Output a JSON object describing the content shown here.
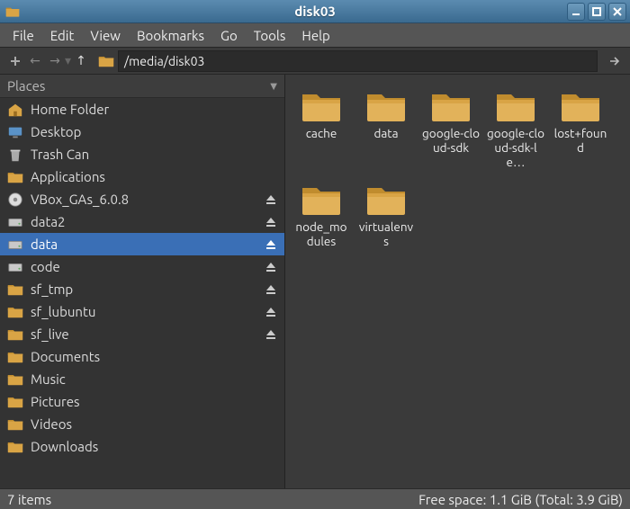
{
  "window": {
    "title": "disk03"
  },
  "menu": {
    "file": "File",
    "edit": "Edit",
    "view": "View",
    "bookmarks": "Bookmarks",
    "go": "Go",
    "tools": "Tools",
    "help": "Help"
  },
  "toolbar": {
    "path": "/media/disk03"
  },
  "sidebar": {
    "header": "Places",
    "items": [
      {
        "label": "Home Folder",
        "icon": "home",
        "eject": false,
        "selected": false
      },
      {
        "label": "Desktop",
        "icon": "desktop",
        "eject": false,
        "selected": false
      },
      {
        "label": "Trash Can",
        "icon": "trash",
        "eject": false,
        "selected": false
      },
      {
        "label": "Applications",
        "icon": "folder",
        "eject": false,
        "selected": false
      },
      {
        "label": "VBox_GAs_6.0.8",
        "icon": "disc",
        "eject": true,
        "selected": false
      },
      {
        "label": "data2",
        "icon": "drive",
        "eject": true,
        "selected": false
      },
      {
        "label": "data",
        "icon": "drive",
        "eject": true,
        "selected": true
      },
      {
        "label": "code",
        "icon": "drive",
        "eject": true,
        "selected": false
      },
      {
        "label": "sf_tmp",
        "icon": "folder",
        "eject": true,
        "selected": false
      },
      {
        "label": "sf_lubuntu",
        "icon": "folder",
        "eject": true,
        "selected": false
      },
      {
        "label": "sf_live",
        "icon": "folder",
        "eject": true,
        "selected": false
      },
      {
        "label": "Documents",
        "icon": "folder",
        "eject": false,
        "selected": false
      },
      {
        "label": "Music",
        "icon": "folder",
        "eject": false,
        "selected": false
      },
      {
        "label": "Pictures",
        "icon": "folder",
        "eject": false,
        "selected": false
      },
      {
        "label": "Videos",
        "icon": "folder",
        "eject": false,
        "selected": false
      },
      {
        "label": "Downloads",
        "icon": "folder",
        "eject": false,
        "selected": false
      }
    ]
  },
  "content": {
    "items": [
      {
        "label": "cache"
      },
      {
        "label": "data"
      },
      {
        "label": "google-cloud-sdk"
      },
      {
        "label": "google-cloud-sdk-le…"
      },
      {
        "label": "lost+found"
      },
      {
        "label": "node_modules"
      },
      {
        "label": "virtualenvs"
      }
    ]
  },
  "status": {
    "left": "7 items",
    "right": "Free space: 1.1 GiB (Total: 3.9 GiB)"
  }
}
